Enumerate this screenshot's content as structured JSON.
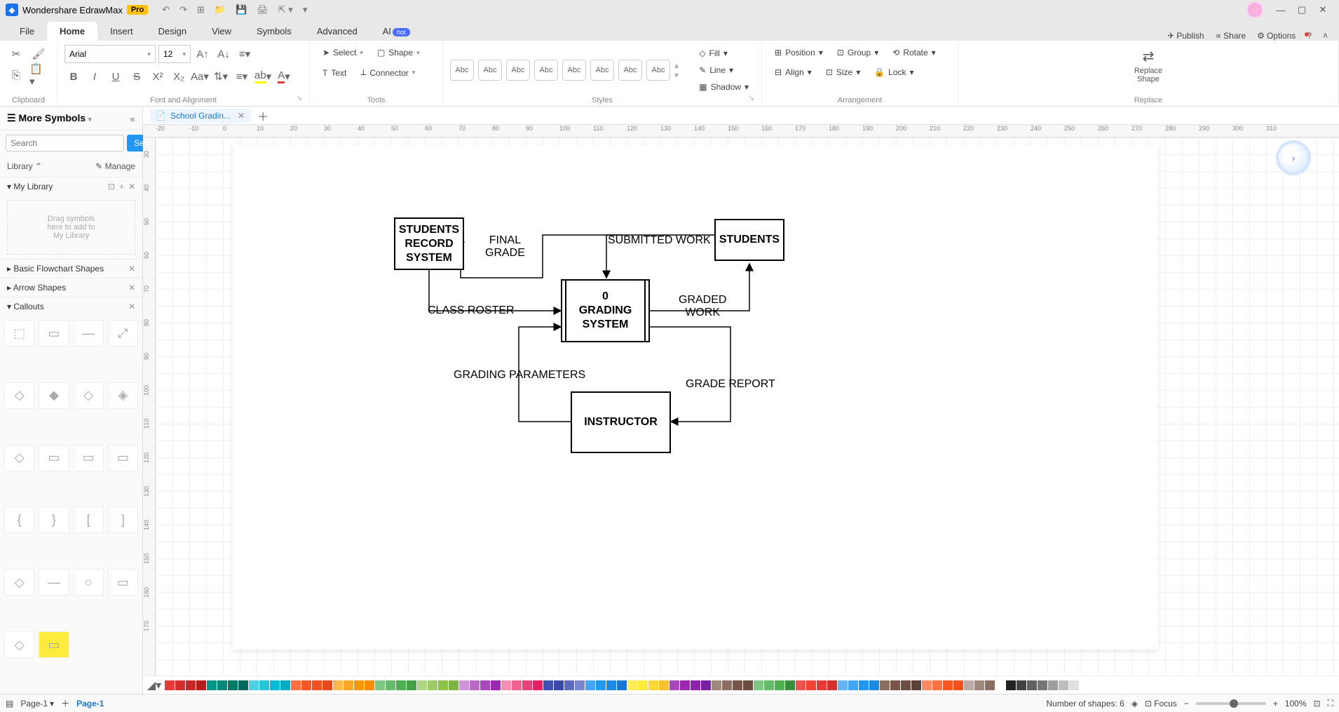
{
  "app": {
    "name": "Wondershare EdrawMax",
    "badge": "Pro"
  },
  "menutabs": [
    "File",
    "Home",
    "Insert",
    "Design",
    "View",
    "Symbols",
    "Advanced",
    "AI"
  ],
  "menutabs_active": 1,
  "ai_badge": "hot",
  "rightmenu": {
    "publish": "Publish",
    "share": "Share",
    "options": "Options"
  },
  "ribbon": {
    "clipboard": "Clipboard",
    "font_label": "Font and Alignment",
    "tools_label": "Tools",
    "styles_label": "Styles",
    "arrangement_label": "Arrangement",
    "replace_label": "Replace",
    "font_name": "Arial",
    "font_size": "12",
    "select": "Select",
    "shape": "Shape",
    "text": "Text",
    "connector": "Connector",
    "style_sample": "Abc",
    "fill": "Fill",
    "line": "Line",
    "shadow": "Shadow",
    "position": "Position",
    "group": "Group",
    "rotate": "Rotate",
    "align": "Align",
    "size": "Size",
    "lock": "Lock",
    "replace_shape": "Replace\nShape"
  },
  "leftpanel": {
    "title": "More Symbols",
    "search_ph": "Search",
    "search_btn": "Search",
    "library": "Library",
    "manage": "Manage",
    "mylib": "My Library",
    "drop_hint": "Drag symbols\nhere to add to\nMy Library",
    "sections": [
      "Basic Flowchart Shapes",
      "Arrow Shapes",
      "Callouts"
    ]
  },
  "doc": {
    "tab_name": "School Gradin..."
  },
  "ruler_h": [
    "-20",
    "-10",
    "0",
    "10",
    "20",
    "30",
    "40",
    "50",
    "60",
    "70",
    "80",
    "90",
    "100",
    "110",
    "120",
    "130",
    "140",
    "150",
    "160",
    "170",
    "180",
    "190",
    "200",
    "210",
    "220",
    "230",
    "240",
    "250",
    "260",
    "270",
    "280",
    "290",
    "300",
    "310"
  ],
  "ruler_v": [
    "30",
    "40",
    "50",
    "60",
    "70",
    "80",
    "90",
    "100",
    "110",
    "120",
    "130",
    "140",
    "150",
    "160",
    "170"
  ],
  "diagram": {
    "nodes": {
      "records": "STUDENTS\nRECORD\nSYSTEM",
      "grading_num": "0",
      "grading": "GRADING\nSYSTEM",
      "students": "STUDENTS",
      "instructor": "INSTRUCTOR"
    },
    "labels": {
      "final_grade": "FINAL\nGRADE",
      "submitted": "SUBMITTED WORK",
      "class_roster": "CLASS ROSTER",
      "graded_work": "GRADED\nWORK",
      "grading_params": "GRADING PARAMETERS",
      "grade_report": "GRADE REPORT"
    }
  },
  "status": {
    "page_btn": "Page-1",
    "page_tab": "Page-1",
    "shape_count_label": "Number of shapes:",
    "shape_count": "6",
    "focus": "Focus",
    "zoom": "100%"
  },
  "colors": [
    "#e53935",
    "#d32f2f",
    "#c62828",
    "#b71c1c",
    "#009688",
    "#00897b",
    "#00796b",
    "#00695c",
    "#4dd0e1",
    "#26c6da",
    "#00bcd4",
    "#00acc1",
    "#ff7043",
    "#ff5722",
    "#f4511e",
    "#e64a19",
    "#ffb74d",
    "#ffa726",
    "#ff9800",
    "#fb8c00",
    "#81c784",
    "#66bb6a",
    "#4caf50",
    "#43a047",
    "#aed581",
    "#9ccc65",
    "#8bc34a",
    "#7cb342",
    "#ce93d8",
    "#ba68c8",
    "#ab47bc",
    "#9c27b0",
    "#f48fb1",
    "#f06292",
    "#ec407a",
    "#e91e63",
    "#3f51b5",
    "#3949ab",
    "#5c6bc0",
    "#7986cb",
    "#42a5f5",
    "#2196f3",
    "#1e88e5",
    "#1976d2",
    "#ffee58",
    "#ffeb3b",
    "#fdd835",
    "#fbc02d",
    "#ab47bc",
    "#9c27b0",
    "#8e24aa",
    "#7b1fa2",
    "#a1887f",
    "#8d6e63",
    "#795548",
    "#6d4c41",
    "#81c784",
    "#66bb6a",
    "#4caf50",
    "#388e3c",
    "#ef5350",
    "#f44336",
    "#e53935",
    "#d32f2f",
    "#64b5f6",
    "#42a5f5",
    "#2196f3",
    "#1e88e5",
    "#8d6e63",
    "#795548",
    "#6d4c41",
    "#5d4037",
    "#ff8a65",
    "#ff7043",
    "#ff5722",
    "#f4511e",
    "#bcaaa4",
    "#a1887f",
    "#8d6e63",
    "#ffffff",
    "#212121",
    "#424242",
    "#616161",
    "#757575",
    "#9e9e9e",
    "#bdbdbd",
    "#e0e0e0"
  ]
}
